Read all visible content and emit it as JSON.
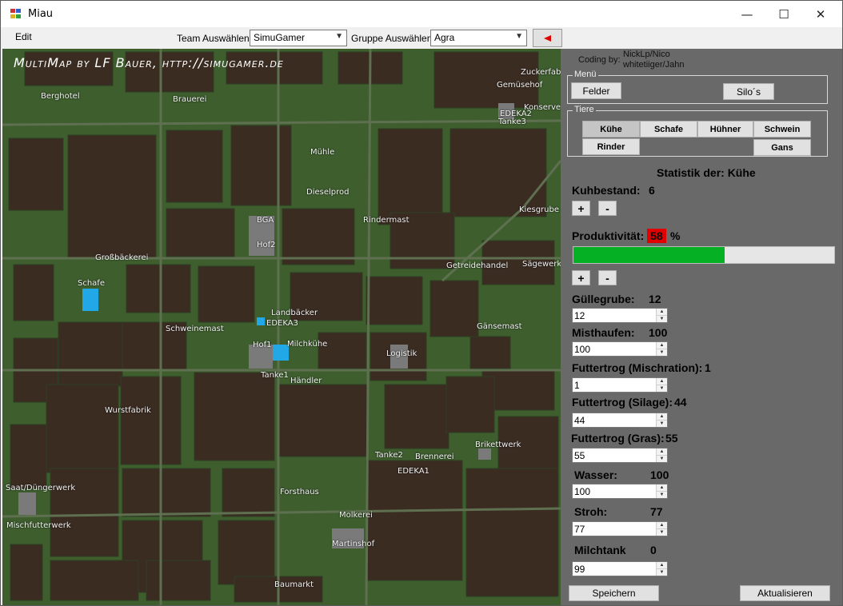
{
  "window": {
    "title": "Miau"
  },
  "menu": {
    "edit": "Edit"
  },
  "toolbar": {
    "team_label": "Team Auswählen:",
    "team_value": "SimuGamer",
    "group_label": "Gruppe Auswählen:",
    "group_value": "Agra"
  },
  "map": {
    "title": "MultiMap by LF Bauer, http://simugamer.de",
    "labels": [
      "Zuckerfabr",
      "Gemüsehof",
      "Konserve",
      "EDEKA2",
      "Tanke3",
      "Berghotel",
      "Brauerei",
      "Mühle",
      "Dieselprod",
      "BGA",
      "Hof2",
      "Rindermast",
      "Kiesgrube",
      "Großbäckerei",
      "Getreidehandel",
      "Sägewerk",
      "Schafe",
      "Landbäcker",
      "EDEKA3",
      "Schweinemast",
      "Gänsemast",
      "Hof1",
      "Milchkühe",
      "Logistik",
      "Tanke1",
      "Händler",
      "Wurstfabrik",
      "Brikettwerk",
      "Tanke2",
      "Brennerei",
      "EDEKA1",
      "Saat/Düngerwerk",
      "Forsthaus",
      "Molkerei",
      "Mischfutterwerk",
      "Martinshof",
      "Baumarkt"
    ]
  },
  "panel": {
    "coding_label": "Coding by:",
    "coders": [
      "NickLp/Nico",
      "whitetiiger/Jahn"
    ],
    "menu_group": {
      "title": "Menü",
      "felder": "Felder",
      "silos": "Silo´s"
    },
    "tiere_group": {
      "title": "Tiere",
      "kuehe": "Kühe",
      "schafe": "Schafe",
      "huehner": "Hühner",
      "schwein": "Schwein",
      "rinder": "Rinder",
      "gans": "Gans"
    },
    "stat_title": "Statistik der: Kühe",
    "kuhbestand_label": "Kuhbestand:",
    "kuhbestand_value": "6",
    "plus": "+",
    "minus": "-",
    "produktivitaet_label": "Produktivität:",
    "produktivitaet_value": "58",
    "produktivitaet_pct": "%",
    "progress_fraction": 0.58,
    "guellegrube_label": "Güllegrube:",
    "guellegrube_value": "12",
    "guellegrube_input": "12",
    "misthaufen_label": "Misthaufen:",
    "misthaufen_value": "100",
    "misthaufen_input": "100",
    "mischration_label": "Futtertrog (Mischration):",
    "mischration_value": "1",
    "mischration_input": "1",
    "silage_label": "Futtertrog (Silage):",
    "silage_value": "44",
    "silage_input": "44",
    "gras_label": "Futtertrog (Gras):",
    "gras_value": "55",
    "gras_input": "55",
    "wasser_label": "Wasser:",
    "wasser_value": "100",
    "wasser_input": "100",
    "stroh_label": "Stroh:",
    "stroh_value": "77",
    "stroh_input": "77",
    "milchtank_label": "Milchtank",
    "milchtank_value": "0",
    "milchtank_input": "99",
    "speichern": "Speichern",
    "aktualisieren": "Aktualisieren"
  },
  "colors": {
    "progress_fill": "#06b025",
    "badge": "#e00000",
    "panel_bg": "#696969"
  }
}
